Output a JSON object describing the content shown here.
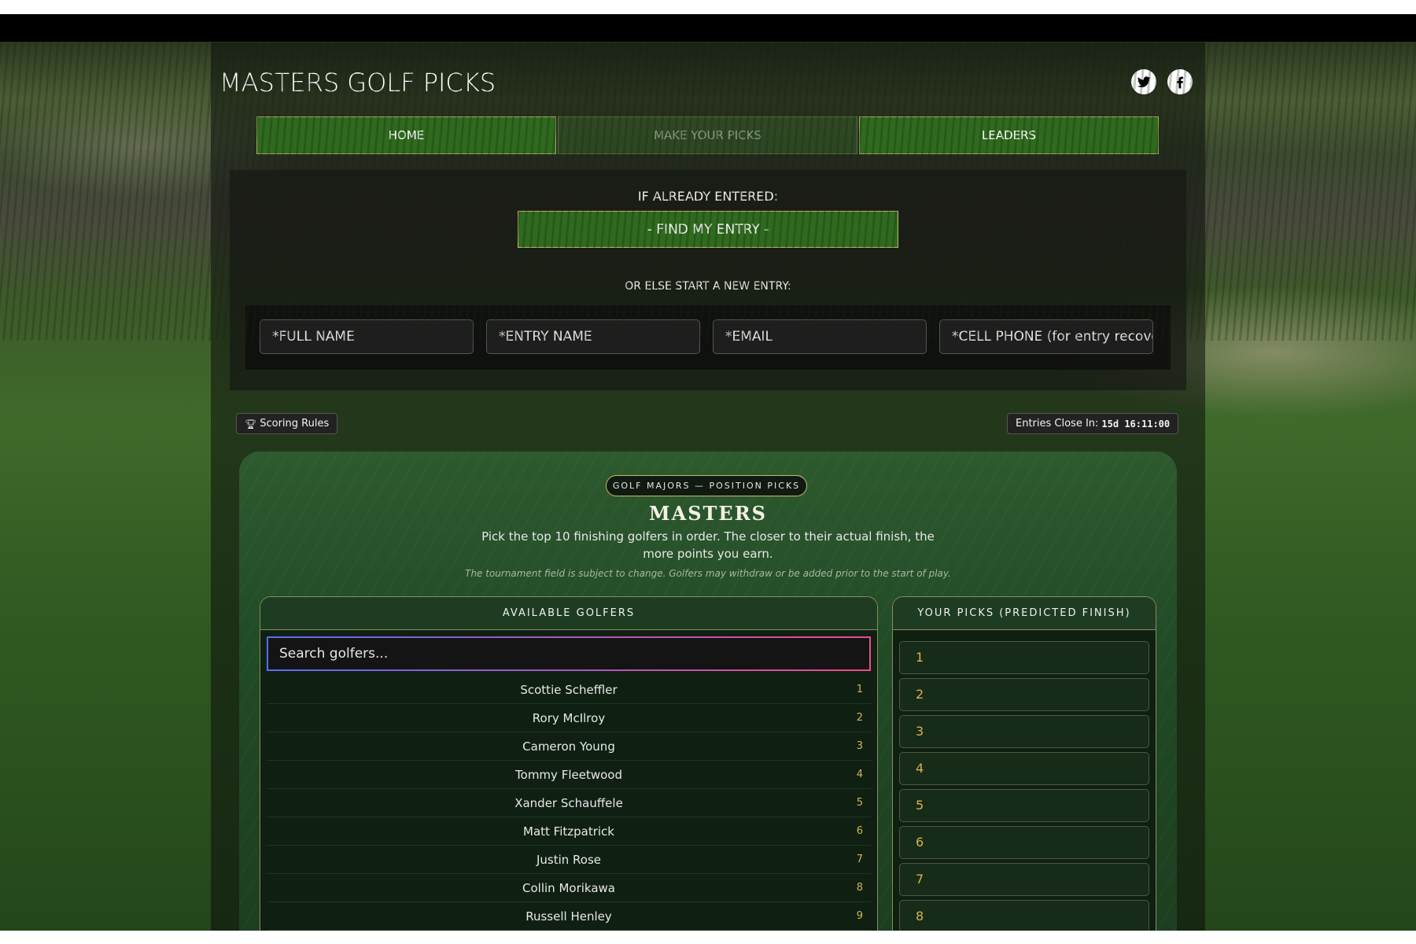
{
  "site": {
    "title": "MASTERS GOLF PICKS"
  },
  "social": {
    "twitter": "twitter-icon",
    "facebook": "facebook-icon"
  },
  "nav": [
    {
      "label": "HOME",
      "active": false
    },
    {
      "label": "MAKE YOUR PICKS",
      "active": true
    },
    {
      "label": "LEADERS",
      "active": false
    }
  ],
  "entry": {
    "already_label": "IF ALREADY ENTERED:",
    "find_button": "- FIND MY ENTRY -",
    "new_label": "OR ELSE START A NEW ENTRY:",
    "fields": [
      {
        "placeholder": "*FULL NAME"
      },
      {
        "placeholder": "*ENTRY NAME"
      },
      {
        "placeholder": "*EMAIL"
      },
      {
        "placeholder": "*CELL PHONE (for entry recove"
      }
    ]
  },
  "scoring_rules": {
    "label": "Scoring Rules",
    "icon": "trophy-icon"
  },
  "countdown": {
    "label": "Entries Close In:",
    "value": "15d 16:11:00"
  },
  "contest": {
    "tag": "GOLF MAJORS — POSITION PICKS",
    "title": "MASTERS",
    "description": "Pick the top 10 finishing golfers in order. The closer to their actual finish, the more points you earn.",
    "note": "The tournament field is subject to change. Golfers may withdraw or be added prior to the start of play."
  },
  "available": {
    "header": "AVAILABLE GOLFERS",
    "search_placeholder": "Search golfers...",
    "golfers": [
      {
        "name": "Scottie Scheffler",
        "rank": "1"
      },
      {
        "name": "Rory McIlroy",
        "rank": "2"
      },
      {
        "name": "Cameron Young",
        "rank": "3"
      },
      {
        "name": "Tommy Fleetwood",
        "rank": "4"
      },
      {
        "name": "Xander Schauffele",
        "rank": "5"
      },
      {
        "name": "Matt Fitzpatrick",
        "rank": "6"
      },
      {
        "name": "Justin Rose",
        "rank": "7"
      },
      {
        "name": "Collin Morikawa",
        "rank": "8"
      },
      {
        "name": "Russell Henley",
        "rank": "9"
      }
    ]
  },
  "picks": {
    "header": "YOUR PICKS (PREDICTED FINISH)",
    "slots": [
      "1",
      "2",
      "3",
      "4",
      "5",
      "6",
      "7",
      "8"
    ]
  }
}
